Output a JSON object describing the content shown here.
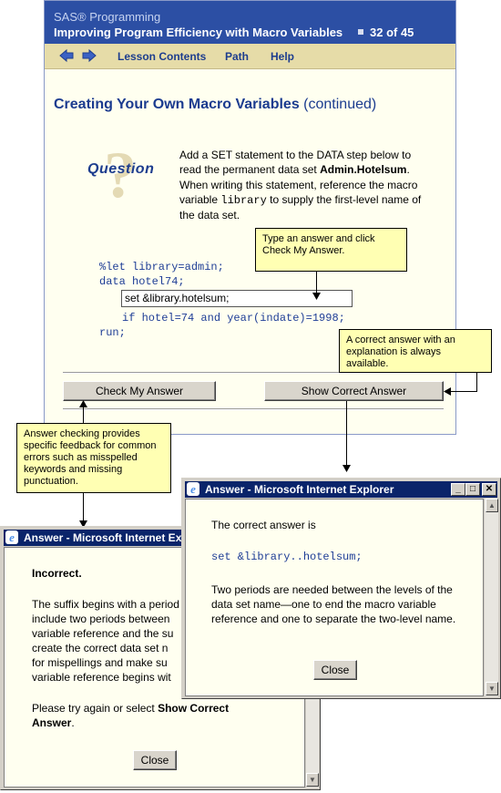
{
  "lesson": {
    "course_title": "SAS® Programming",
    "lesson_title": "Improving Program Efficiency with Macro Variables",
    "page_counter": "32 of 45",
    "nav": {
      "back_icon": "back-arrow-icon",
      "forward_icon": "forward-arrow-icon",
      "lesson_contents": "Lesson Contents",
      "path": "Path",
      "help": "Help"
    },
    "heading": "Creating Your Own Macro Variables",
    "heading_suffix": "(continued)",
    "question_label": "Question",
    "question": {
      "part1": "Add a SET statement to the DATA step below to read the permanent data set",
      "dataset": "Admin.Hotelsum",
      "part2": ". When writing this statement, reference the macro variable",
      "macro_var": "library",
      "part3": "to supply the first-level name of the data set."
    },
    "code": {
      "line1": "%let library=admin;",
      "line2": "data hotel74;",
      "answer_value": "set &library.hotelsum;",
      "line4": "if hotel=74 and year(indate)=1998;",
      "line5": "run;"
    },
    "check_button": "Check My Answer",
    "show_button": "Show Correct Answer"
  },
  "callouts": {
    "type_answer": "Type an answer and click Check My Answer.",
    "correct_answer": "A correct answer with an explanation is always available.",
    "answer_checking": "Answer checking provides specific feedback for common errors such as misspelled keywords and missing punctuation."
  },
  "dialog_incorrect": {
    "title": "Answer - Microsoft Internet Explorer",
    "heading": "Incorrect.",
    "body_lines": [
      "The suffix begins with a period",
      "include two periods between",
      "variable reference and the su",
      "create the correct data set n",
      "for mispellings and make su",
      "variable reference begins wit"
    ],
    "try_again": "Please try again or select",
    "try_again_bold": "Show Correct Answer",
    "try_again_end": ".",
    "close_button": "Close"
  },
  "dialog_correct": {
    "title": "Answer - Microsoft Internet Explorer",
    "intro": "The correct answer is",
    "answer_code": "set &library..hotelsum;",
    "explanation": "Two periods are needed between the levels of the data set name—one to end the macro variable reference and one to separate the two-level name.",
    "close_button": "Close",
    "minimize_icon": "minimize-icon",
    "maximize_icon": "maximize-icon",
    "close_icon": "close-icon"
  }
}
